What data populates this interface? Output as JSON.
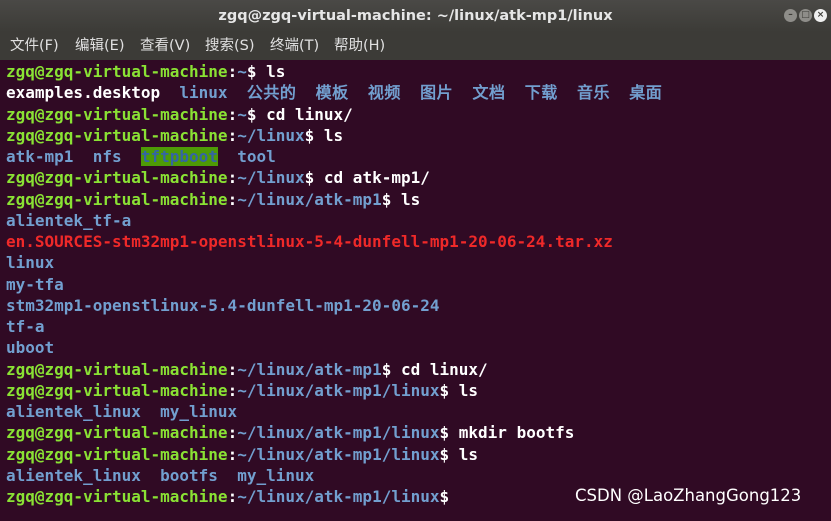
{
  "window": {
    "title": "zgq@zgq-virtual-machine: ~/linux/atk-mp1/linux",
    "min_glyph": "–",
    "max_glyph": "□",
    "close_glyph": "×"
  },
  "menu": [
    "文件(F)",
    "编辑(E)",
    "查看(V)",
    "搜索(S)",
    "终端(T)",
    "帮助(H)"
  ],
  "prompt": {
    "user": "zgq@zgq-virtual-machine",
    "sep": ":"
  },
  "terminal": {
    "l1": {
      "path": "~",
      "cmd": "$ ls"
    },
    "l2": [
      "examples.desktop",
      "linux",
      "公共的",
      "模板",
      "视频",
      "图片",
      "文档",
      "下载",
      "音乐",
      "桌面"
    ],
    "l3": {
      "path": "~",
      "cmd": "$ cd linux/"
    },
    "l4": {
      "path": "~/linux",
      "cmd": "$ ls"
    },
    "l5": [
      "atk-mp1",
      "nfs",
      "tftpboot",
      "tool"
    ],
    "l6": {
      "path": "~/linux",
      "cmd": "$ cd atk-mp1/"
    },
    "l7": {
      "path": "~/linux/atk-mp1",
      "cmd": "$ ls"
    },
    "l8": "alientek_tf-a",
    "l9": "en.SOURCES-stm32mp1-openstlinux-5-4-dunfell-mp1-20-06-24.tar.xz",
    "l10": "linux",
    "l11": "my-tfa",
    "l12": "stm32mp1-openstlinux-5.4-dunfell-mp1-20-06-24",
    "l13": "tf-a",
    "l14": "uboot",
    "l15": {
      "path": "~/linux/atk-mp1",
      "cmd": "$ cd linux/"
    },
    "l16": {
      "path": "~/linux/atk-mp1/linux",
      "cmd": "$ ls"
    },
    "l17": [
      "alientek_linux",
      "my_linux"
    ],
    "l18": {
      "path": "~/linux/atk-mp1/linux",
      "cmd": "$ mkdir bootfs"
    },
    "l19": {
      "path": "~/linux/atk-mp1/linux",
      "cmd": "$ ls"
    },
    "l20": [
      "alientek_linux",
      "bootfs",
      "my_linux"
    ],
    "l21": {
      "path": "~/linux/atk-mp1/linux",
      "cmd": "$"
    }
  },
  "watermark": "CSDN @LaoZhangGong123",
  "colors": {
    "background": "#300a24",
    "prompt_user": "#8ae234",
    "path_and_dirs": "#729fcf",
    "archive": "#ef2929",
    "tftpboot_highlight": "#4e9a06"
  }
}
